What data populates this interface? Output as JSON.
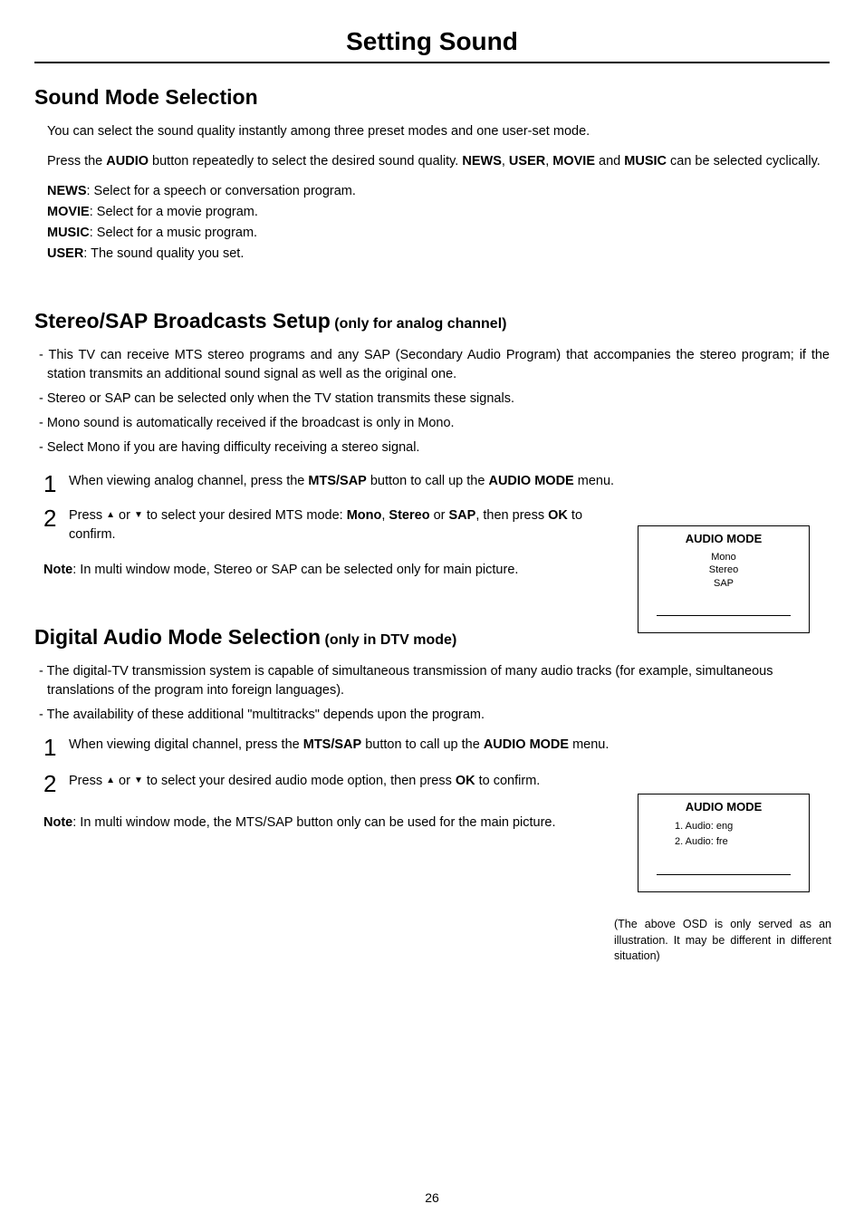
{
  "page_title": "Setting Sound",
  "page_number": "26",
  "section1": {
    "heading": "Sound Mode Selection",
    "intro": "You can select the sound quality instantly among three preset modes and one user-set mode.",
    "press_line_prefix": "Press the ",
    "press_bold1": "AUDIO",
    "press_line_mid": " button repeatedly to select the desired sound quality. ",
    "press_bold2": "NEWS",
    "press_sep": ", ",
    "press_bold3": "USER",
    "press_bold4": "MOVIE",
    "press_and": " and ",
    "press_bold5": "MUSIC",
    "press_line_suffix": " can be selected cyclically.",
    "lines": [
      {
        "label": "NEWS",
        "text": ": Select for a speech or conversation program."
      },
      {
        "label": "MOVIE",
        "text": ": Select for a movie program."
      },
      {
        "label": "MUSIC",
        "text": ": Select for a music program."
      },
      {
        "label": "USER",
        "text": ": The sound quality you set."
      }
    ]
  },
  "section2": {
    "heading": "Stereo/SAP Broadcasts Setup",
    "sub": " (only for analog channel)",
    "dashes": [
      "- This TV can receive MTS stereo programs and any SAP (Secondary Audio Program) that accompanies the stereo program; if the station transmits an additional sound signal as well as the original one.",
      "- Stereo or SAP can be selected only when the TV station transmits these signals.",
      "- Mono sound is automatically received if the broadcast is only in Mono.",
      "- Select Mono if you are having difficulty receiving a stereo signal."
    ],
    "step1_a": "When viewing analog channel, press the ",
    "step1_b": "MTS/SAP",
    "step1_c": " button to call up the ",
    "step1_d": "AUDIO MODE",
    "step1_e": " menu.",
    "step2_a": "Press ",
    "step2_b": " or ",
    "step2_c": " to select your desired MTS mode: ",
    "step2_d": "Mono",
    "step2_e": "Stereo",
    "step2_f": " or ",
    "step2_g": "SAP",
    "step2_h": ", then press ",
    "step2_i": "OK",
    "step2_j": " to confirm.",
    "note_label": "Note",
    "note_text": ": In multi window mode, Stereo or SAP can be selected only for main picture."
  },
  "section3": {
    "heading": "Digital Audio Mode Selection",
    "sub": " (only in DTV mode)",
    "dash1": "- The digital-TV transmission system is capable of simultaneous transmission of many audio tracks (for example, simultaneous translations of the program into foreign languages).",
    "dash2": "- The availability of these additional \"multitracks\" depends upon the program.",
    "step1_a": "When viewing digital channel, press the ",
    "step1_b": "MTS/SAP",
    "step1_c": " button to call up the ",
    "step1_d": "AUDIO MODE",
    "step1_e": " menu.",
    "step2_a": "Press ",
    "step2_b": " or ",
    "step2_c": " to select your desired audio mode option, then press ",
    "step2_d": "OK",
    "step2_e": " to confirm.",
    "note_label": "Note",
    "note_text": ": In multi window mode, the MTS/SAP button only can be used for the main picture."
  },
  "osd1": {
    "title": "AUDIO MODE",
    "items": [
      "Mono",
      "Stereo",
      "SAP"
    ]
  },
  "osd2": {
    "title": "AUDIO MODE",
    "items": [
      "1. Audio: eng",
      "2. Audio: fre"
    ],
    "caption": "(The above OSD is only served as an illustration. It may be different in different situation)"
  }
}
